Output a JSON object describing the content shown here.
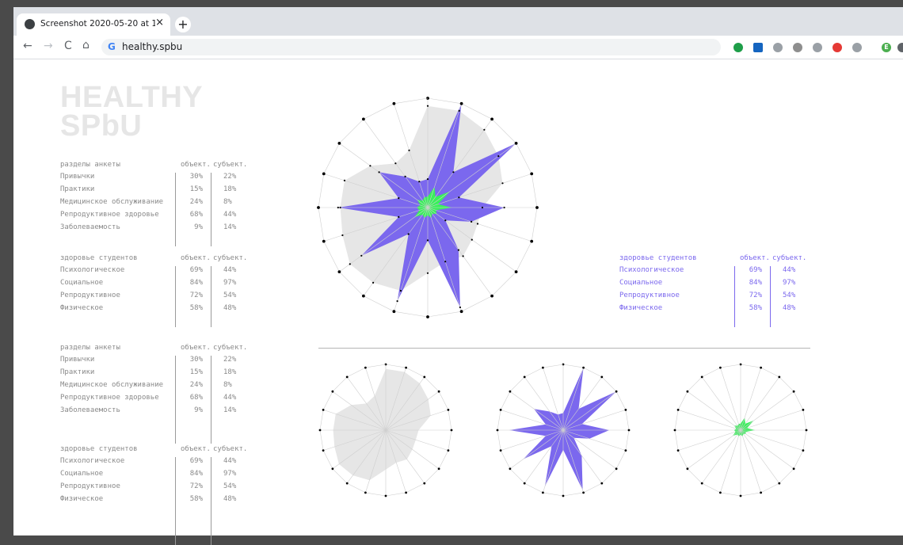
{
  "browser": {
    "tab_title": "Screenshot 2020-05-20 at 11.",
    "close_glyph": "×",
    "new_tab_glyph": "+",
    "url": "healthy.spbu",
    "nav": {
      "back": "←",
      "forward": "→",
      "reload": "C",
      "home": "⌂"
    },
    "extensions": [
      {
        "name": "check-extension-icon",
        "color": "#1e9e49"
      },
      {
        "name": "s-extension-icon",
        "color": "#1565c0"
      },
      {
        "name": "camera-extension-icon",
        "color": "#9aa0a6"
      },
      {
        "name": "circle-extension-icon",
        "color": "#8e8e8e"
      },
      {
        "name": "dropbox-extension-icon",
        "color": "#9aa0a6"
      },
      {
        "name": "block-extension-icon",
        "color": "#e53935"
      },
      {
        "name": "gauge-extension-icon",
        "color": "#9aa0a6"
      },
      {
        "name": "profile-avatar-icon",
        "color": "#4caf50",
        "label": "E"
      },
      {
        "name": "menu-extension-icon",
        "color": "#5f6368"
      }
    ]
  },
  "logo": {
    "line1": "HEALTHY",
    "line2": "SPbU"
  },
  "tables": [
    {
      "header": [
        "разделы анкеты",
        "объект.",
        "субъект."
      ],
      "rows": [
        [
          "Привычки",
          "30%",
          "22%"
        ],
        [
          "Практики",
          "15%",
          "18%"
        ],
        [
          "Медицинское обслуживание",
          "24%",
          "8%"
        ],
        [
          "Репродуктивное здоровье",
          "68%",
          "44%"
        ],
        [
          "Заболеваемость",
          "9%",
          "14%"
        ]
      ]
    },
    {
      "header": [
        "здоровье студентов",
        "объект.",
        "субъект."
      ],
      "rows": [
        [
          "Психологическое",
          "69%",
          "44%"
        ],
        [
          "Социальное",
          "84%",
          "97%"
        ],
        [
          "Репродуктивное",
          "72%",
          "54%"
        ],
        [
          "Физическое",
          "58%",
          "48%"
        ]
      ]
    },
    {
      "header": [
        "разделы анкеты",
        "объект.",
        "субъект."
      ],
      "rows": [
        [
          "Привычки",
          "30%",
          "22%"
        ],
        [
          "Практики",
          "15%",
          "18%"
        ],
        [
          "Медицинское обслуживание",
          "24%",
          "8%"
        ],
        [
          "Репродуктивное здоровье",
          "68%",
          "44%"
        ],
        [
          "Заболеваемость",
          "9%",
          "14%"
        ]
      ]
    },
    {
      "header": [
        "здоровье студентов",
        "объект.",
        "субъект."
      ],
      "rows": [
        [
          "Психологическое",
          "69%",
          "44%"
        ],
        [
          "Социальное",
          "84%",
          "97%"
        ],
        [
          "Репродуктивное",
          "72%",
          "54%"
        ],
        [
          "Физическое",
          "58%",
          "48%"
        ]
      ]
    },
    {
      "header": [
        "здоровье студентов",
        "объект.",
        "субъект."
      ],
      "rows": [
        [
          "Психологическое",
          "69%",
          "44%"
        ],
        [
          "Социальное",
          "84%",
          "97%"
        ],
        [
          "Репродуктивное",
          "72%",
          "54%"
        ],
        [
          "Физическое",
          "58%",
          "48%"
        ]
      ]
    }
  ],
  "colors": {
    "grey_area": "#e6e6e6",
    "purple": "#7b68ee",
    "green": "#39f05b",
    "spoke": "#cfcfcf",
    "dot": "#000000"
  },
  "chart_data": [
    {
      "type": "radar",
      "axes": 20,
      "max": 1,
      "series": [
        {
          "color": "#e6e6e6",
          "values": [
            0.93,
            0.93,
            0.88,
            0.8,
            0.72,
            0.5,
            0.48,
            0.5,
            0.55,
            0.52,
            0.6,
            0.8,
            0.85,
            0.88,
            0.82,
            0.8,
            0.8,
            0.65,
            0.5,
            0.55
          ]
        },
        {
          "color": "#7b68ee",
          "values": [
            0.26,
            1.0,
            0.4,
            1.0,
            0.3,
            0.7,
            0.42,
            0.2,
            0.48,
            0.96,
            0.3,
            0.9,
            0.3,
            0.75,
            0.28,
            0.82,
            0.28,
            0.55,
            0.35,
            0.25
          ]
        },
        {
          "color": "#39f05b",
          "values": [
            0.1,
            0.2,
            0.12,
            0.25,
            0.1,
            0.22,
            0.08,
            0.1,
            0.07,
            0.1,
            0.07,
            0.1,
            0.08,
            0.15,
            0.08,
            0.1,
            0.07,
            0.12,
            0.08,
            0.1
          ]
        }
      ]
    }
  ]
}
